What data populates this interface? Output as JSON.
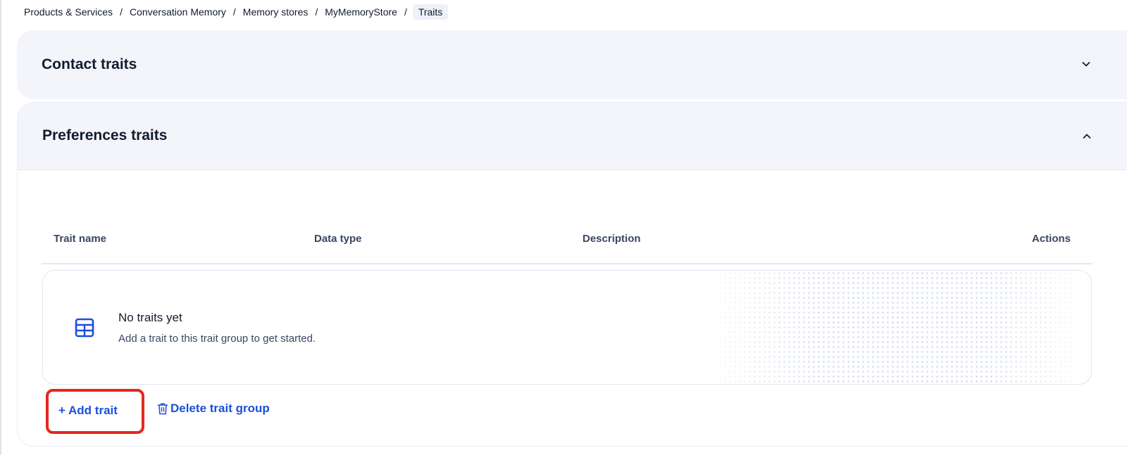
{
  "breadcrumb": {
    "items": [
      "Products & Services",
      "Conversation Memory",
      "Memory stores",
      "MyMemoryStore"
    ],
    "current": "Traits",
    "separator": "/"
  },
  "panels": {
    "contact": {
      "title": "Contact traits",
      "expanded": false
    },
    "preferences": {
      "title": "Preferences traits",
      "expanded": true
    }
  },
  "table": {
    "columns": [
      "Trait name",
      "Data type",
      "Description",
      "Actions"
    ]
  },
  "empty_state": {
    "icon": "table-icon",
    "title": "No traits yet",
    "description": "Add a trait to this trait group to get started."
  },
  "actions": {
    "add_trait": "+ Add trait",
    "delete_group": "Delete trait group"
  },
  "colors": {
    "link": "#1b4fdc",
    "highlight_border": "#e8261b",
    "panel_bg": "#f4f5fb"
  }
}
